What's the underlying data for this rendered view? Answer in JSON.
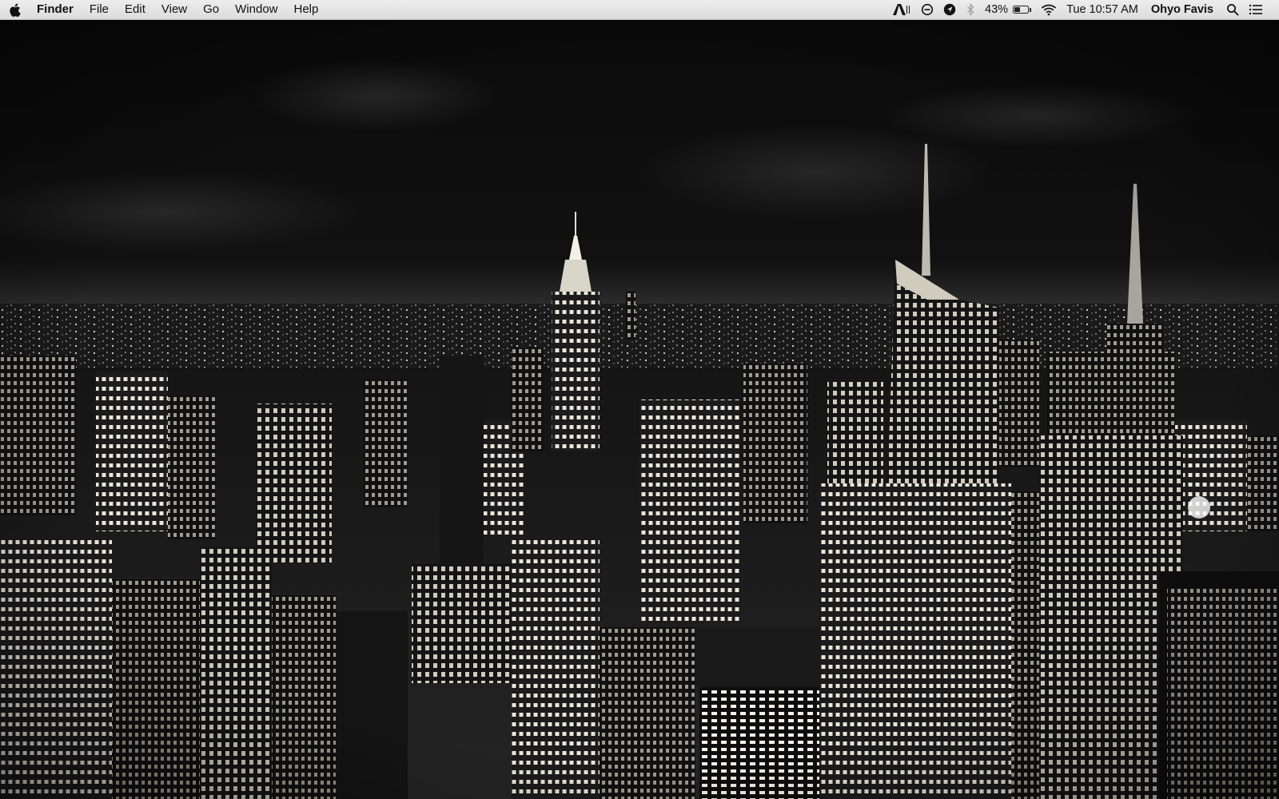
{
  "menubar": {
    "app_name": "Finder",
    "menus": [
      "File",
      "Edit",
      "View",
      "Go",
      "Window",
      "Help"
    ],
    "status": {
      "battery_percent": "43%",
      "battery_level": 0.43,
      "clock": "Tue 10:57 AM",
      "user": "Ohyo Favis"
    },
    "icons": [
      "apple-icon",
      "adobe-icon",
      "dnd-icon",
      "location-icon",
      "bluetooth-icon",
      "battery-icon",
      "wifi-icon",
      "spotlight-icon",
      "notification-center-icon"
    ]
  },
  "desktop": {
    "wallpaper": "night-city-skyline"
  },
  "colors": {
    "menubar_bg": "#e6e6e6",
    "sky": "#101010",
    "lights": "#f4f1e6"
  }
}
